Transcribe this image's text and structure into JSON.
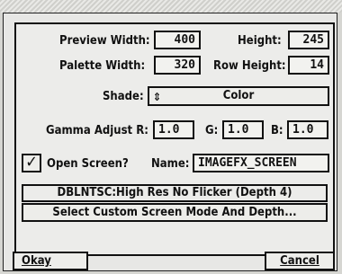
{
  "preview_width": {
    "label": "Preview Width:",
    "value": "400"
  },
  "height": {
    "label": "Height:",
    "value": "245"
  },
  "palette_width": {
    "label": "Palette Width:",
    "value": "320"
  },
  "row_height": {
    "label": "Row Height:",
    "value": "14"
  },
  "shade": {
    "label": "Shade:",
    "value": "Color"
  },
  "gamma": {
    "label_r": "Gamma Adjust R:",
    "r": "1.0",
    "label_g": "G:",
    "g": "1.0",
    "label_b": "B:",
    "b": "1.0"
  },
  "open_screen": {
    "check": "✓",
    "label": "Open Screen?",
    "checked": true
  },
  "name": {
    "label": "Name:",
    "value": "IMAGEFX_SCREEN"
  },
  "screen_mode": {
    "status": "DBLNTSC:High Res No Flicker (Depth 4)",
    "button": "Select Custom Screen Mode And Depth..."
  },
  "buttons": {
    "okay": "Okay",
    "cancel": "Cancel"
  }
}
